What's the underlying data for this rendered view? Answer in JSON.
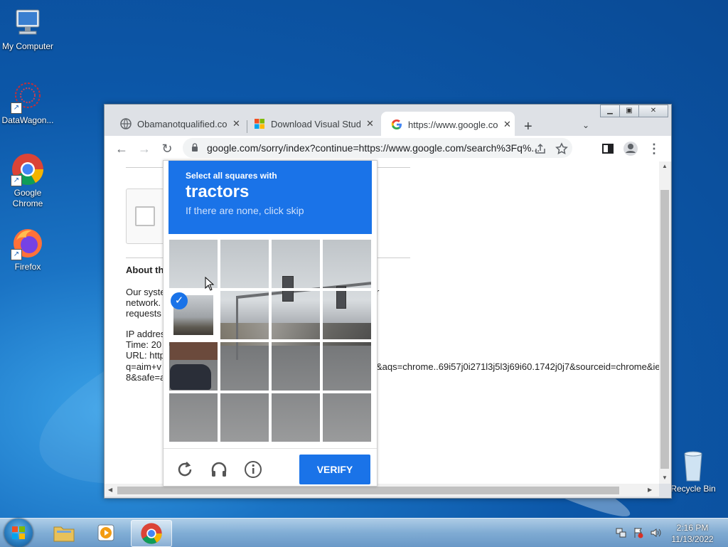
{
  "desktop": {
    "icons": [
      {
        "label": "My Computer"
      },
      {
        "label": "DataWagon..."
      },
      {
        "label": "Google Chrome"
      },
      {
        "label": "Firefox"
      },
      {
        "label": "Recycle Bin"
      }
    ]
  },
  "browser": {
    "tabs": [
      {
        "title": "Obamanotqualified.com",
        "icon": "globe-icon"
      },
      {
        "title": "Download Visual Studio",
        "icon": "microsoft-logo-icon"
      },
      {
        "title": "https://www.google.com",
        "icon": "google-logo-icon",
        "active": true
      }
    ],
    "tab_close": "✕",
    "new_tab": "+",
    "tab_menu": "⌄",
    "url": "google.com/sorry/index?continue=https://www.google.com/search%3Fq%..."
  },
  "page": {
    "about_heading": "About th",
    "para1": [
      "Our syste",
      "network.",
      "requests"
    ],
    "para1_tail": "r",
    "ip": [
      "IP addres",
      "Time: 20",
      "URL: http",
      "q=aim+v",
      "8&safe=a"
    ],
    "url_tail": "&aqs=chrome..69i57j0i271l3j5l3j69i60.1742j0j7&sourceid=chrome&ie"
  },
  "captcha": {
    "instruction": "Select all squares with",
    "target": "tractors",
    "hint": "If there are none, click skip",
    "verify_label": "VERIFY",
    "selected_cells": [
      [
        1,
        0
      ]
    ]
  },
  "taskbar": {
    "time": "2:16 PM",
    "date": "11/13/2022"
  },
  "colors": {
    "accent": "#1a73e8"
  }
}
